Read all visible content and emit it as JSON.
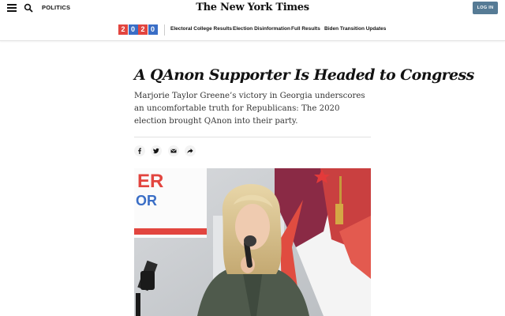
{
  "header": {
    "section": "POLITICS",
    "logo": "The New York Times",
    "login_label": "LOG IN",
    "icons": [
      "menu-icon",
      "search-icon"
    ]
  },
  "election_bar": {
    "year_digits": [
      "2",
      "0",
      "2",
      "0"
    ],
    "year_colors": [
      "#e2453f",
      "#3a6ec6",
      "#e2453f",
      "#3a6ec6"
    ],
    "links": [
      "Electoral College Results",
      "Election Disinformation",
      "Full Results",
      "Biden Transition Updates"
    ]
  },
  "article": {
    "headline": "A QAnon Supporter Is Headed to Congress",
    "summary": "Marjorie Taylor Greene’s victory in Georgia underscores an uncomfortable truth for Republicans: The 2020 election brought QAnon into their party.",
    "share_icons": [
      "facebook-icon",
      "twitter-icon",
      "email-icon",
      "share-icon"
    ]
  },
  "photo": {
    "sign_text_1": "ER",
    "sign_text_2": "OR"
  },
  "colors": {
    "login_bg": "#567b95",
    "red": "#e2453f",
    "blue": "#3a6ec6"
  }
}
